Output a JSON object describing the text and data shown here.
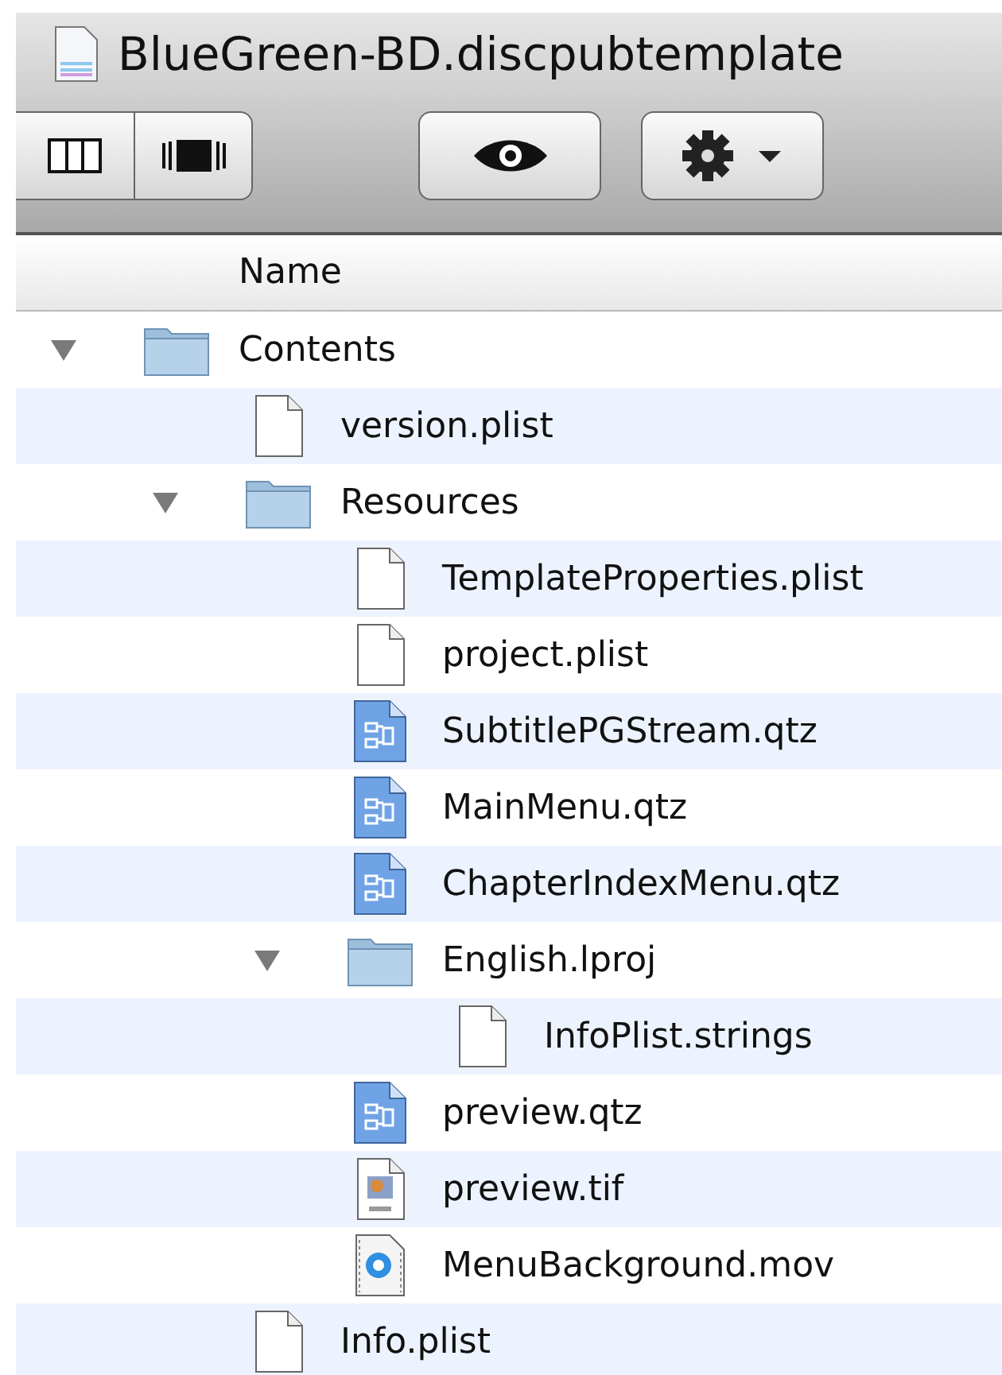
{
  "window": {
    "title": "BlueGreen-BD.discpubtemplate"
  },
  "toolbar": {
    "buttons": [
      {
        "kind": "columns"
      },
      {
        "kind": "coverflow"
      },
      {
        "kind": "quicklook"
      },
      {
        "kind": "action"
      }
    ]
  },
  "column_header": "Name",
  "tree": [
    {
      "name": "Contents",
      "kind": "folder",
      "expanded": true,
      "children": [
        {
          "name": "version.plist",
          "kind": "file"
        },
        {
          "name": "Resources",
          "kind": "folder",
          "expanded": true,
          "children": [
            {
              "name": "TemplateProperties.plist",
              "kind": "file"
            },
            {
              "name": "project.plist",
              "kind": "file"
            },
            {
              "name": "SubtitlePGStream.qtz",
              "kind": "composition"
            },
            {
              "name": "MainMenu.qtz",
              "kind": "composition"
            },
            {
              "name": "ChapterIndexMenu.qtz",
              "kind": "composition"
            },
            {
              "name": "English.lproj",
              "kind": "folder",
              "expanded": true,
              "children": [
                {
                  "name": "InfoPlist.strings",
                  "kind": "file"
                }
              ]
            },
            {
              "name": "preview.qtz",
              "kind": "composition"
            },
            {
              "name": "preview.tif",
              "kind": "image"
            },
            {
              "name": "MenuBackground.mov",
              "kind": "movie"
            }
          ]
        },
        {
          "name": "Info.plist",
          "kind": "file"
        }
      ]
    }
  ]
}
